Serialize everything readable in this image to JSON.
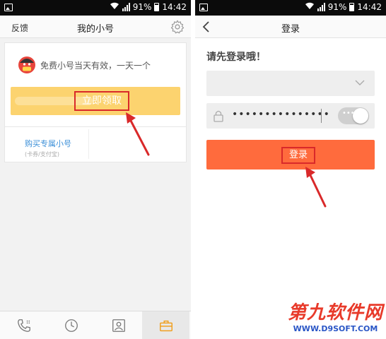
{
  "status_bar": {
    "battery": "91%",
    "time": "14:42"
  },
  "left_screen": {
    "feedback": "反馈",
    "title": "我的小号",
    "free_tip": "免费小号当天有效，一天一个",
    "claim_button": "立即领取",
    "buy_title": "购买专属小号",
    "buy_subtitle": "(卡券/支付宝)",
    "icons": [
      "call-icon",
      "clock-icon",
      "contact-icon",
      "toolbox-icon"
    ]
  },
  "right_screen": {
    "title": "登录",
    "heading": "请先登录哦！",
    "password_mask": "•••••••••••••••",
    "login_button": "登录"
  },
  "watermark": {
    "name": "第九软件网",
    "url": "WWW.D9SOFT.COM"
  },
  "colors": {
    "accent_yellow": "#fcd36f",
    "accent_orange": "#ff6b3d",
    "highlight_red": "#d9292a",
    "link_blue": "#3b8fd8"
  }
}
